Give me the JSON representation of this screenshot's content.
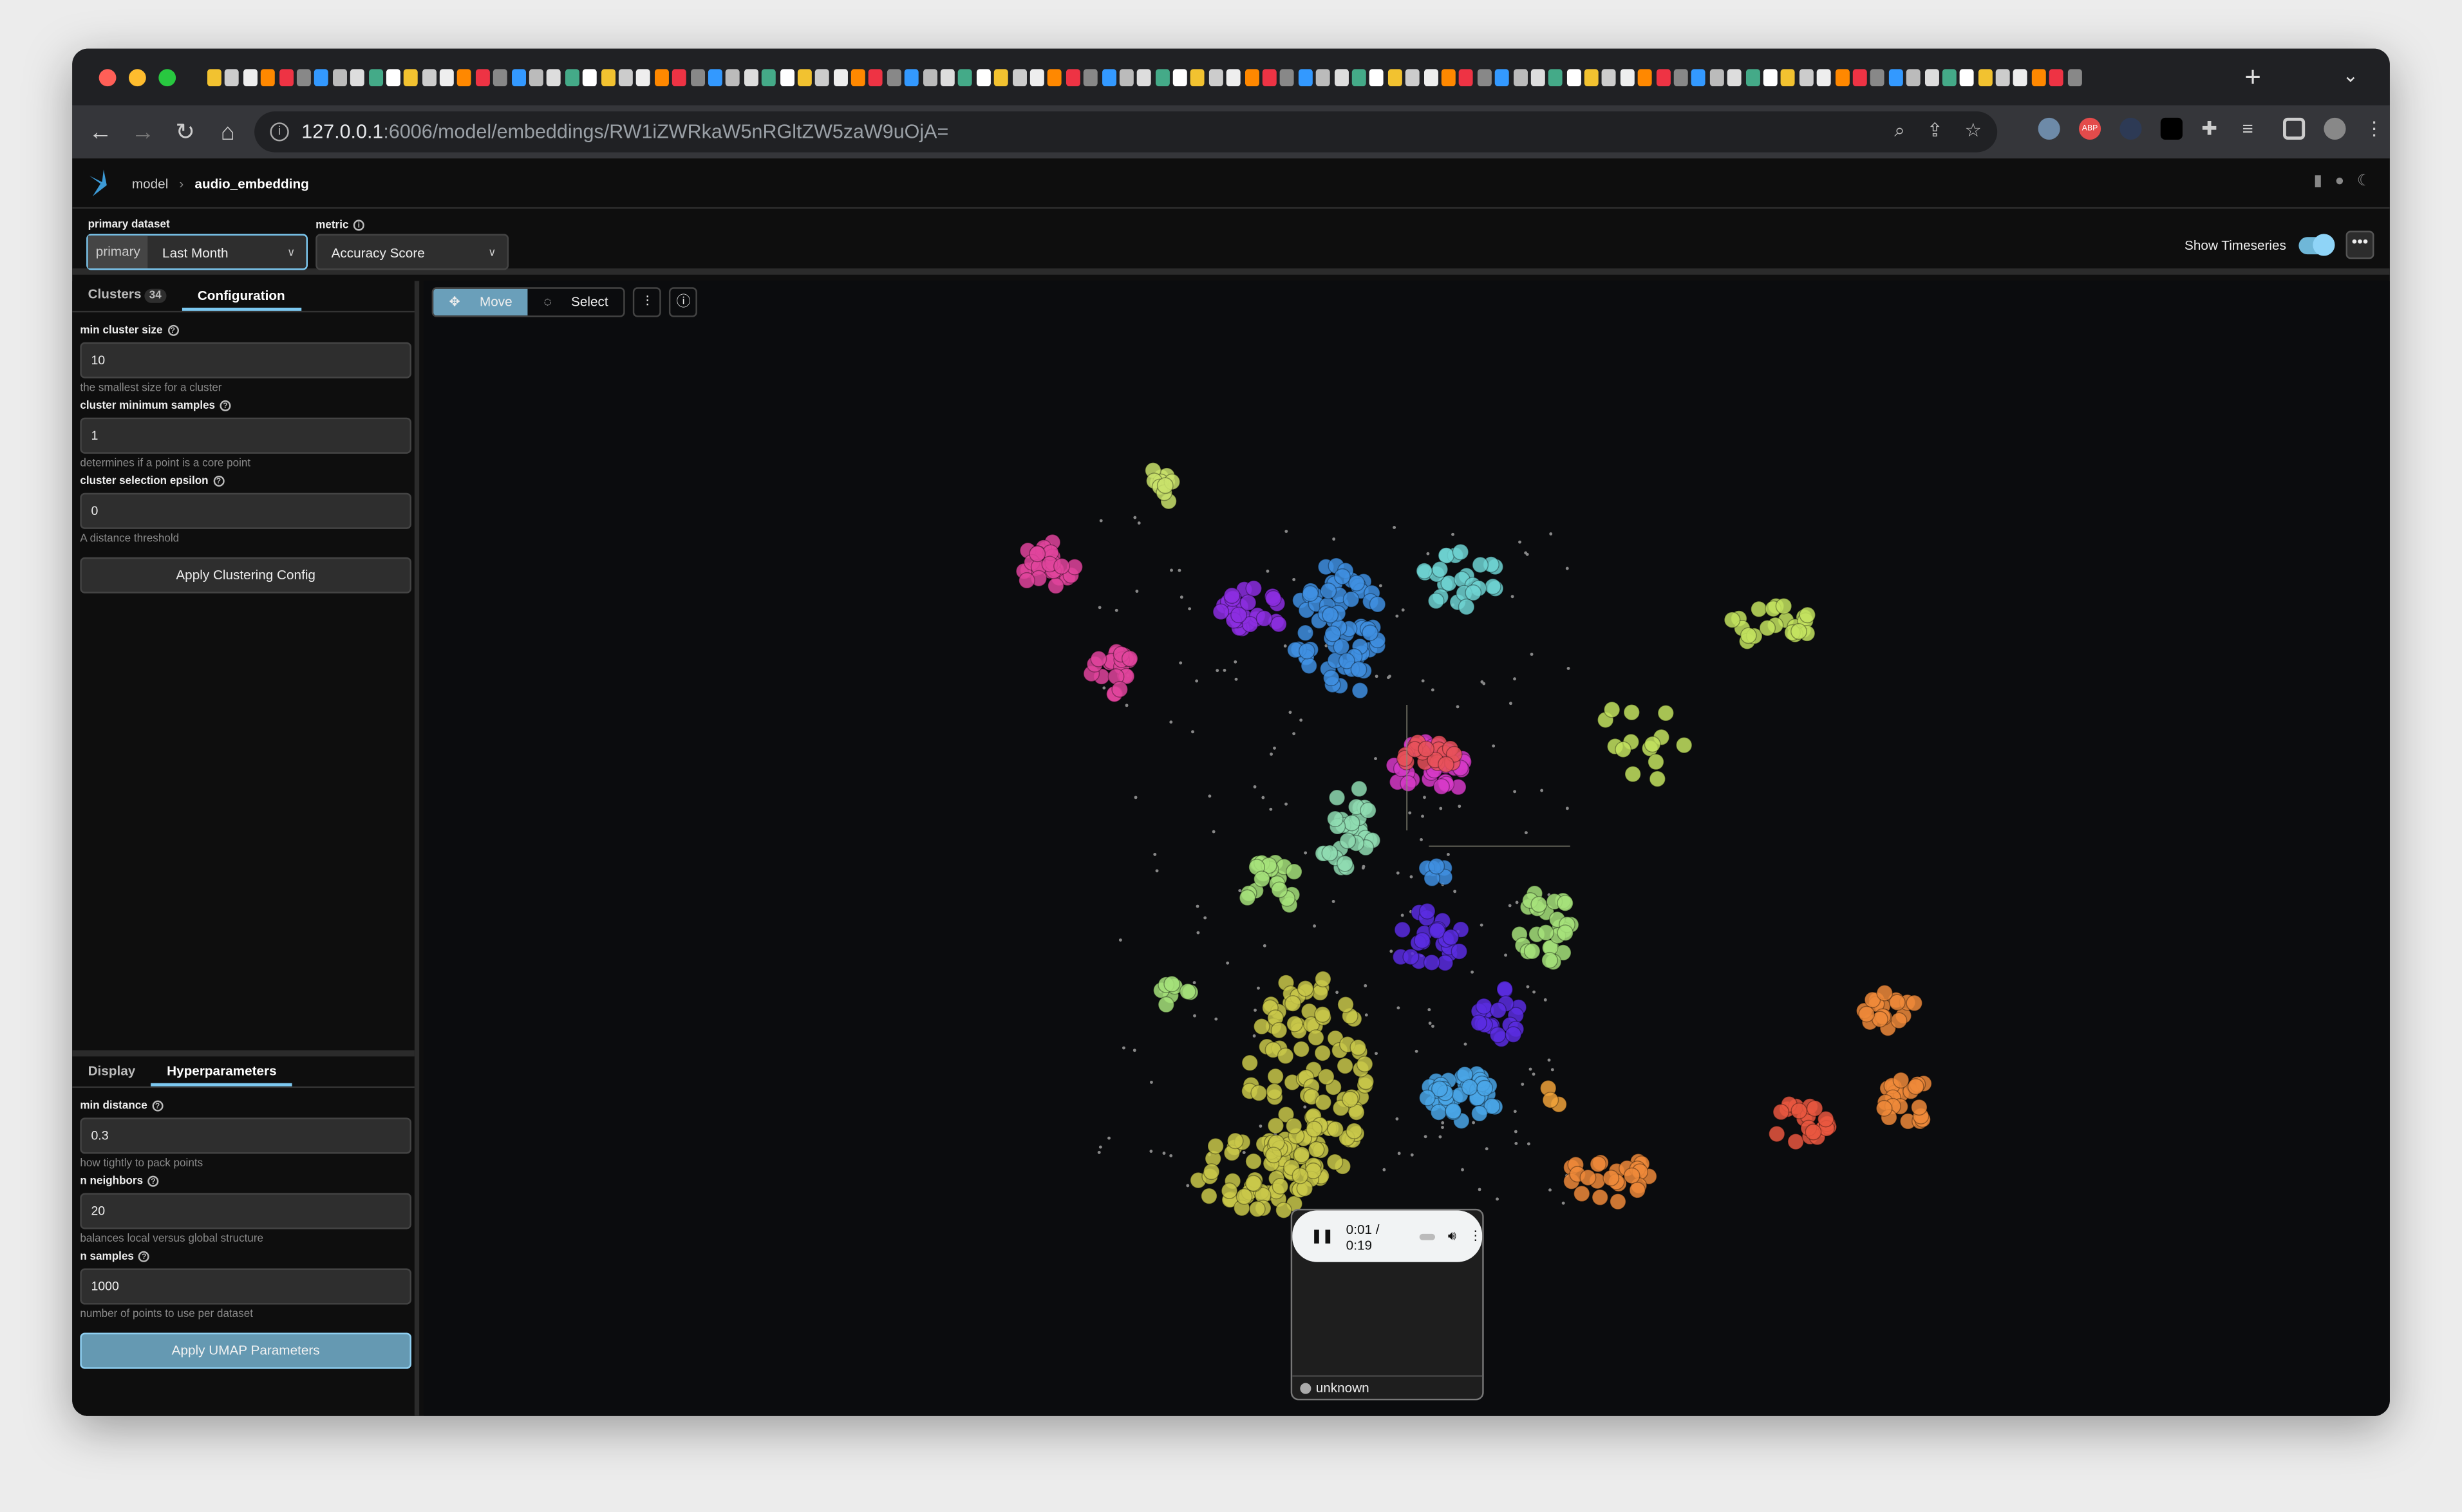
{
  "browser": {
    "url_host": "127.0.0.1",
    "url_rest": ":6006/model/embeddings/RW1iZWRkaW5nRGltZW5zaW9uOjA=",
    "new_tab": "+",
    "ext_abp": "ABP"
  },
  "header": {
    "crumb_root": "model",
    "crumb_sep": "›",
    "crumb_current": "audio_embedding"
  },
  "controls": {
    "primary_dataset_label": "primary dataset",
    "primary_tag": "primary",
    "primary_value": "Last Month",
    "metric_label": "metric",
    "metric_value": "Accuracy Score",
    "show_timeseries": "Show Timeseries",
    "show_timeseries_on": true,
    "more": "•••"
  },
  "cluster_panel": {
    "tabs": [
      {
        "label": "Clusters",
        "count": "34"
      },
      {
        "label": "Configuration"
      }
    ],
    "active_tab": "Configuration",
    "fields": [
      {
        "label": "min cluster size",
        "value": "10",
        "hint": "the smallest size for a cluster"
      },
      {
        "label": "cluster minimum samples",
        "value": "1",
        "hint": "determines if a point is a core point"
      },
      {
        "label": "cluster selection epsilon",
        "value": "0",
        "hint": "A distance threshold"
      }
    ],
    "apply": "Apply Clustering Config"
  },
  "umap_panel": {
    "tabs": [
      {
        "label": "Display"
      },
      {
        "label": "Hyperparameters"
      }
    ],
    "active_tab": "Hyperparameters",
    "fields": [
      {
        "label": "min distance",
        "value": "0.3",
        "hint": "how tightly to pack points"
      },
      {
        "label": "n neighbors",
        "value": "20",
        "hint": "balances local versus global structure"
      },
      {
        "label": "n samples",
        "value": "1000",
        "hint": "number of points to use per dataset"
      }
    ],
    "apply": "Apply UMAP Parameters"
  },
  "canvas": {
    "move": "Move",
    "select": "Select",
    "active_mode": "Move",
    "cluster_colors": [
      "#c9e26b",
      "#e0449c",
      "#8c2ee0",
      "#3f8fe0",
      "#6ed3d2",
      "#c3e35f",
      "#d63ac7",
      "#e8515a",
      "#8fdcb1",
      "#a6e27a",
      "#5a2de0",
      "#4aa6e6",
      "#c9c84a",
      "#ef8a3a",
      "#e9573f",
      "#f0a23a",
      "#888888"
    ],
    "popup": {
      "time": "0:01 / 0:19",
      "label": "unknown"
    }
  },
  "accent": "#7cc8f0"
}
